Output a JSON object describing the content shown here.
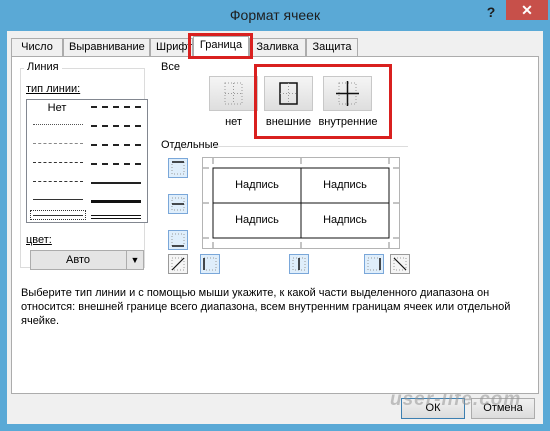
{
  "window": {
    "title": "Формат ячеек",
    "help": "?",
    "close": "✕"
  },
  "tabs": [
    {
      "label": "Число"
    },
    {
      "label": "Выравнивание"
    },
    {
      "label": "Шрифт"
    },
    {
      "label": "Граница"
    },
    {
      "label": "Заливка"
    },
    {
      "label": "Защита"
    }
  ],
  "line": {
    "group_title": "Линия",
    "type_label": "тип линии:",
    "none_label": "Нет",
    "color_label": "цвет:",
    "color_value": "Авто"
  },
  "presets": {
    "group_title": "Все",
    "items": [
      {
        "label": "нет",
        "icon": "border-none-icon"
      },
      {
        "label": "внешние",
        "icon": "border-outline-icon"
      },
      {
        "label": "внутренние",
        "icon": "border-inside-icon"
      }
    ]
  },
  "border": {
    "group_title": "Отдельные",
    "cell_text": [
      "Надпись",
      "Надпись",
      "Надпись",
      "Надпись"
    ]
  },
  "hint": "Выберите тип линии и с помощью мыши укажите, к какой части выделенного диапазона он относится: внешней границе всего диапазона, всем внутренним границам ячеек или отдельной ячейке.",
  "buttons": {
    "ok": "ОК",
    "cancel": "Отмена"
  },
  "watermark": "user-life.com",
  "colors": {
    "titlebar": "#5aa9d6",
    "close": "#c7504a",
    "highlight": "#d9201f"
  }
}
